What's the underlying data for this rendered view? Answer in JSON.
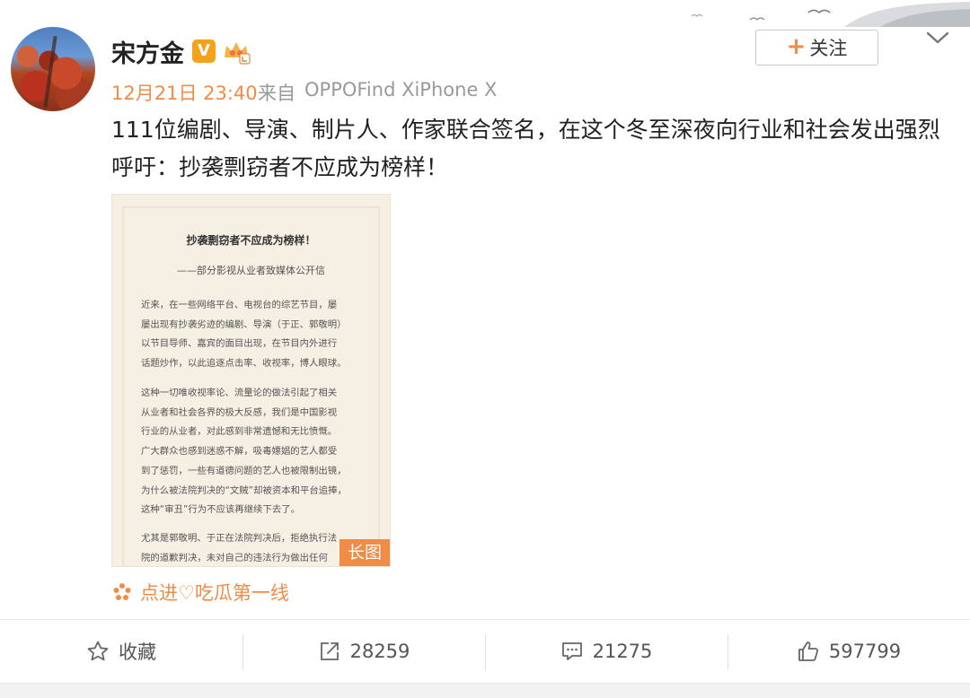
{
  "post": {
    "username": "宋方金",
    "verified_badge": "V",
    "time": "12月21日 23:40",
    "source_prefix": "来自",
    "source_device": "OPPOFind XiPhone X",
    "follow_label": "关注",
    "follow_icon": "plus-icon",
    "text": "111位编剧、导演、制片人、作家联合签名，在这个冬至深夜向行业和社会发出强烈呼吁：抄袭剽窃者不应成为榜样！"
  },
  "letter": {
    "title": "抄袭剽窃者不应成为榜样！",
    "subtitle": "——部分影视从业者致媒体公开信",
    "para1": "近来，在一些网络平台、电视台的综艺节目，屡\n屡出现有抄袭劣迹的编剧、导演（于正、郭敬明）\n以节目导师、嘉宾的面目出现，在节目内外进行\n话题炒作，以此追逐点击率、收视率，博人眼球。",
    "para2": "这种一切唯收视率论、流量论的做法引起了相关\n从业者和社会各界的极大反感，我们是中国影视\n行业的从业者，对此感到非常遗憾和无比愤慨。\n广大群众也感到迷惑不解，吸毒嫖娼的艺人都受\n到了惩罚，一些有道德问题的艺人也被限制出镜，\n为什么被法院判决的“文贼”却被资本和平台追捧，\n这种“审丑”行为不应该再继续下去了。",
    "para3": "尤其是郭敬明、于正在法院判决后，拒绝执行法\n院的道歉判决，未对自己的违法行为做出任何",
    "long_badge": "长图"
  },
  "topic": {
    "icon": "flower-icon",
    "label": "点进♡吃瓜第一线"
  },
  "actions": {
    "favorite_label": "收藏",
    "favorite_icon": "star-icon",
    "repost_count": "28259",
    "repost_icon": "share-icon",
    "comment_count": "21275",
    "comment_icon": "comment-icon",
    "like_count": "597799",
    "like_icon": "thumb-up-icon"
  },
  "colors": {
    "accent": "#f08c47",
    "verified": "#f2a21b",
    "text": "#222222",
    "muted": "#999999"
  }
}
